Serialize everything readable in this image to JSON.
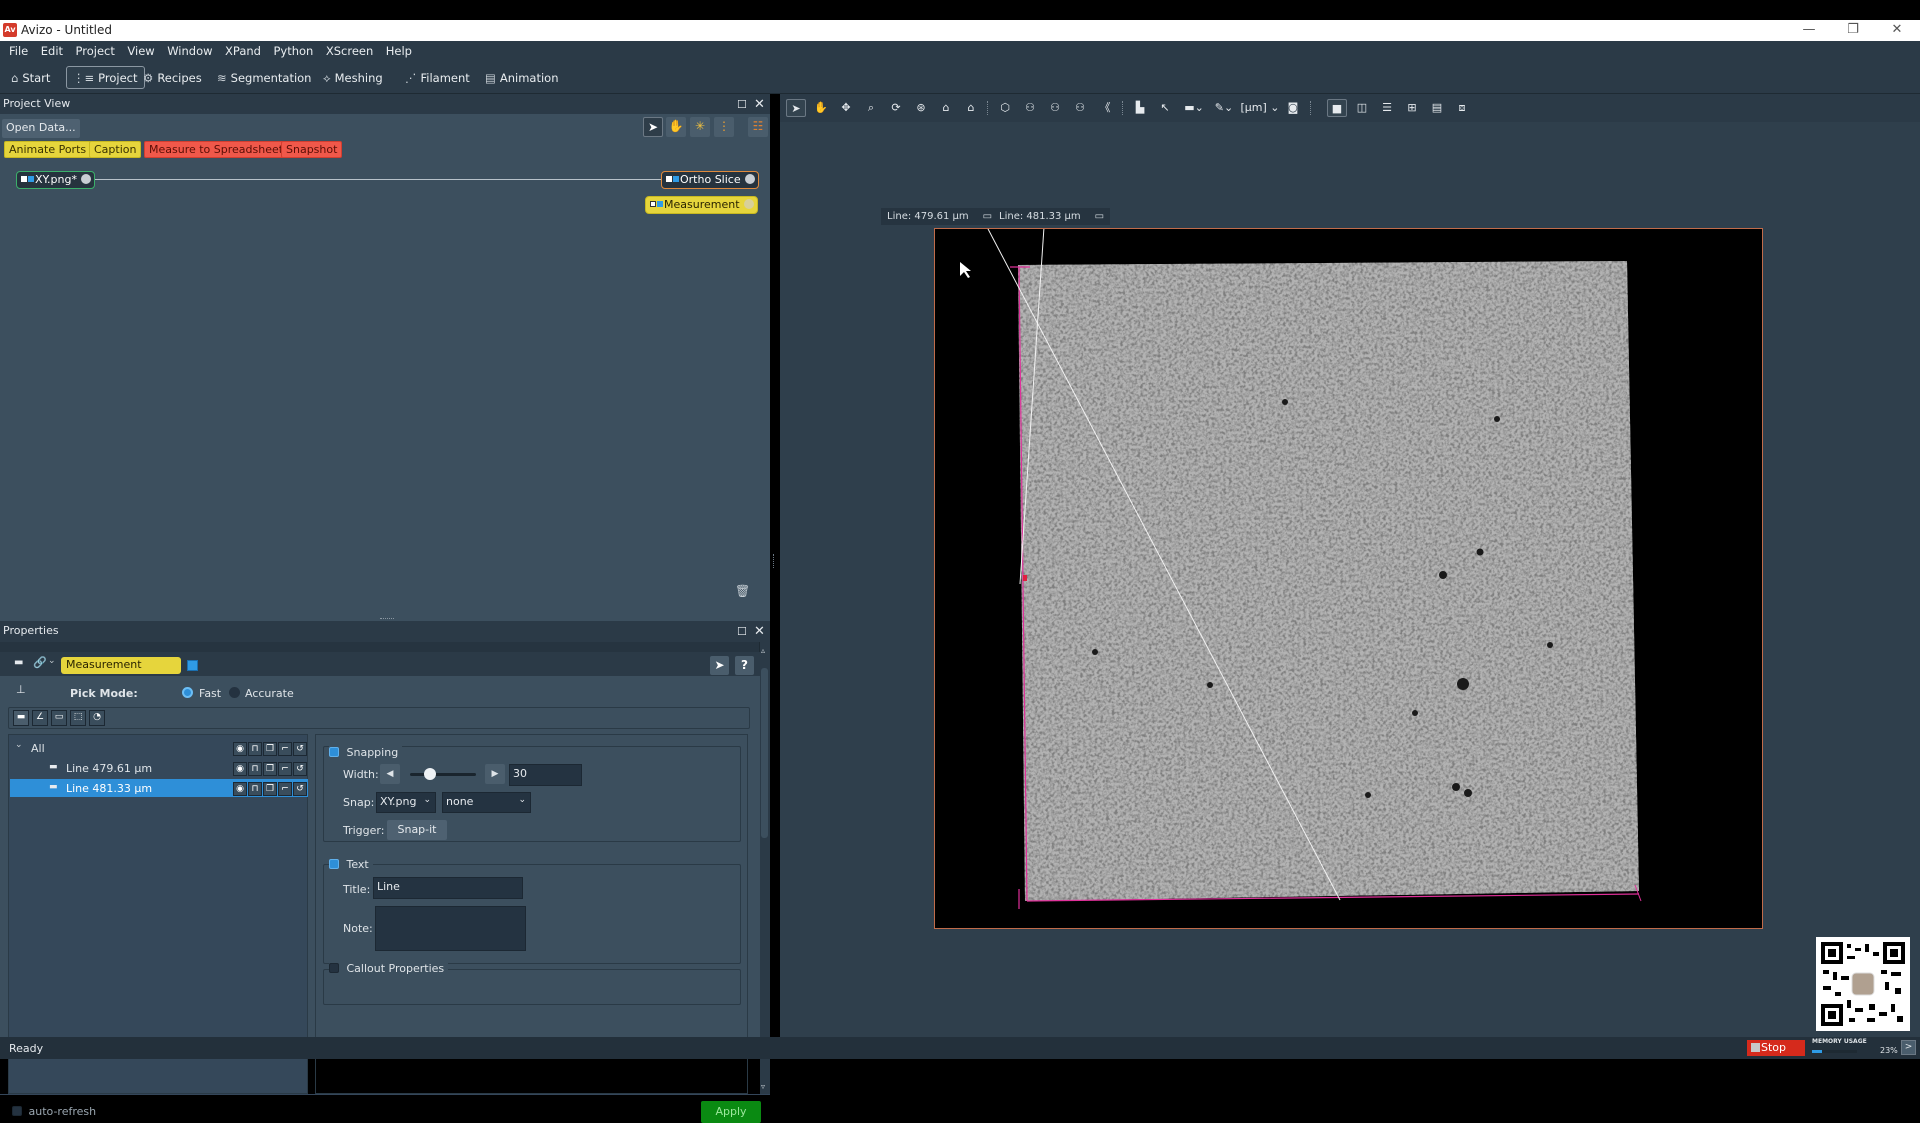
{
  "window": {
    "title": "Avizo - Untitled",
    "logo_text": "Av",
    "controls": {
      "minimize": "—",
      "restore": "❐",
      "close": "✕"
    }
  },
  "menubar": {
    "items": [
      "File",
      "Edit",
      "Project",
      "View",
      "Window",
      "XPand",
      "Python",
      "XScreen",
      "Help"
    ]
  },
  "workrooms": {
    "items": [
      {
        "label": "Start",
        "icon": "home-icon",
        "glyph": "⌂"
      },
      {
        "label": "Project",
        "icon": "project-tree-icon",
        "glyph": "⋮≡",
        "active": true
      },
      {
        "label": "Recipes",
        "icon": "gears-icon",
        "glyph": "⚙"
      },
      {
        "label": "Segmentation",
        "icon": "layers-icon",
        "glyph": "≋"
      },
      {
        "label": "Meshing",
        "icon": "mesh-icon",
        "glyph": "⟡"
      },
      {
        "label": "Filament",
        "icon": "filament-icon",
        "glyph": "⋰"
      },
      {
        "label": "Animation",
        "icon": "clapper-icon",
        "glyph": "▤"
      }
    ]
  },
  "project_view": {
    "title": "Project View",
    "open_data_label": "Open Data...",
    "quick_buttons": [
      {
        "label": "Animate Ports",
        "color": "yellow"
      },
      {
        "label": "Caption",
        "color": "yellow"
      },
      {
        "label": "Measure to Spreadsheet",
        "color": "red"
      },
      {
        "label": "Snapshot",
        "color": "red"
      }
    ],
    "nodes": {
      "data": "XY.png*",
      "ortho": "Ortho Slice",
      "measurement": "Measurement"
    },
    "tool_icons": [
      "pointer-icon",
      "hand-icon",
      "connect-icon",
      "tree-view-icon",
      "layout-icon"
    ]
  },
  "properties": {
    "title": "Properties",
    "module_name": "Measurement",
    "module_color": "#2f9be6",
    "pick_mode": {
      "label": "Pick Mode:",
      "options": [
        "Fast",
        "Accurate"
      ],
      "selected": "Fast"
    },
    "tree": {
      "root": "All",
      "items": [
        {
          "label": "Line 479.61 µm",
          "selected": false
        },
        {
          "label": "Line 481.33 µm",
          "selected": true
        }
      ]
    },
    "snapping": {
      "label": "Snapping",
      "checked": true,
      "width_label": "Width:",
      "width_value": "30",
      "width_slider_fraction": 0.3,
      "snap_label": "Snap:",
      "snap_source": "XY.png",
      "snap_mode": "none",
      "trigger_label": "Trigger:",
      "trigger_button": "Snap-it"
    },
    "text": {
      "label": "Text",
      "checked": true,
      "title_label": "Title:",
      "title_value": "Line",
      "note_label": "Note:",
      "note_value": ""
    },
    "callout": {
      "label": "Callout Properties",
      "checked": false
    },
    "auto_refresh": "auto-refresh",
    "apply": "Apply"
  },
  "viewer": {
    "measure_tags": [
      "Line: 479.61 µm",
      "Line: 481.33 µm"
    ],
    "unit_label": "[µm]"
  },
  "statusbar": {
    "status": "Ready",
    "stop": "Stop",
    "memory_label": "MEMORY USAGE",
    "memory_percent": "23%",
    "memory_fraction": 0.23
  }
}
